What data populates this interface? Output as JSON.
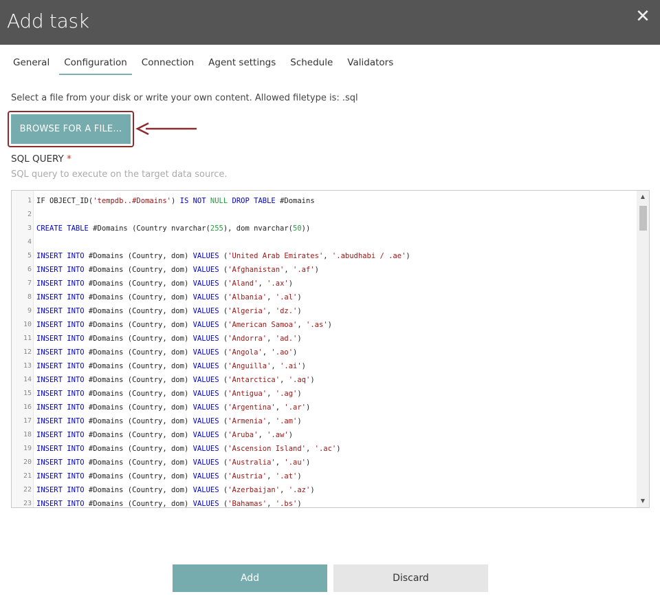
{
  "dialog": {
    "title": "Add task",
    "close_icon": "close-icon"
  },
  "tabs": [
    {
      "label": "General"
    },
    {
      "label": "Configuration",
      "active": true
    },
    {
      "label": "Connection"
    },
    {
      "label": "Agent settings"
    },
    {
      "label": "Schedule"
    },
    {
      "label": "Validators"
    }
  ],
  "config": {
    "hint": "Select a file from your disk or write your own content. Allowed filetype is: .sql",
    "browse_label": "BROWSE FOR A FILE...",
    "field_label": "SQL QUERY",
    "required_mark": "*",
    "field_help": "SQL query to execute on the target data source."
  },
  "editor": {
    "lines": [
      [
        [
          "t",
          "IF OBJECT_ID("
        ],
        [
          "s",
          "'tempdb..#Domains'"
        ],
        [
          "t",
          ") "
        ],
        [
          "k",
          "IS NOT"
        ],
        [
          "t",
          " "
        ],
        [
          "g",
          "NULL"
        ],
        [
          "t",
          " "
        ],
        [
          "k",
          "DROP TABLE"
        ],
        [
          "t",
          " #Domains"
        ]
      ],
      [],
      [
        [
          "k",
          "CREATE TABLE"
        ],
        [
          "t",
          " #Domains (Country nvarchar("
        ],
        [
          "n",
          "255"
        ],
        [
          "t",
          "), dom nvarchar("
        ],
        [
          "n",
          "50"
        ],
        [
          "t",
          "))"
        ]
      ],
      [],
      [
        [
          "k",
          "INSERT INTO"
        ],
        [
          "t",
          " #Domains (Country, dom) "
        ],
        [
          "k",
          "VALUES"
        ],
        [
          "t",
          " ("
        ],
        [
          "s",
          "'United Arab Emirates'"
        ],
        [
          "t",
          ", "
        ],
        [
          "s",
          "'.abudhabi / .ae'"
        ],
        [
          "t",
          ")"
        ]
      ],
      [
        [
          "k",
          "INSERT INTO"
        ],
        [
          "t",
          " #Domains (Country, dom) "
        ],
        [
          "k",
          "VALUES"
        ],
        [
          "t",
          " ("
        ],
        [
          "s",
          "'Afghanistan'"
        ],
        [
          "t",
          ", "
        ],
        [
          "s",
          "'.af'"
        ],
        [
          "t",
          ")"
        ]
      ],
      [
        [
          "k",
          "INSERT INTO"
        ],
        [
          "t",
          " #Domains (Country, dom) "
        ],
        [
          "k",
          "VALUES"
        ],
        [
          "t",
          " ("
        ],
        [
          "s",
          "'Aland'"
        ],
        [
          "t",
          ", "
        ],
        [
          "s",
          "'.ax'"
        ],
        [
          "t",
          ")"
        ]
      ],
      [
        [
          "k",
          "INSERT INTO"
        ],
        [
          "t",
          " #Domains (Country, dom) "
        ],
        [
          "k",
          "VALUES"
        ],
        [
          "t",
          " ("
        ],
        [
          "s",
          "'Albania'"
        ],
        [
          "t",
          ", "
        ],
        [
          "s",
          "'.al'"
        ],
        [
          "t",
          ")"
        ]
      ],
      [
        [
          "k",
          "INSERT INTO"
        ],
        [
          "t",
          " #Domains (Country, dom) "
        ],
        [
          "k",
          "VALUES"
        ],
        [
          "t",
          " ("
        ],
        [
          "s",
          "'Algeria'"
        ],
        [
          "t",
          ", "
        ],
        [
          "s",
          "'dz.'"
        ],
        [
          "t",
          ")"
        ]
      ],
      [
        [
          "k",
          "INSERT INTO"
        ],
        [
          "t",
          " #Domains (Country, dom) "
        ],
        [
          "k",
          "VALUES"
        ],
        [
          "t",
          " ("
        ],
        [
          "s",
          "'American Samoa'"
        ],
        [
          "t",
          ", "
        ],
        [
          "s",
          "'.as'"
        ],
        [
          "t",
          ")"
        ]
      ],
      [
        [
          "k",
          "INSERT INTO"
        ],
        [
          "t",
          " #Domains (Country, dom) "
        ],
        [
          "k",
          "VALUES"
        ],
        [
          "t",
          " ("
        ],
        [
          "s",
          "'Andorra'"
        ],
        [
          "t",
          ", "
        ],
        [
          "s",
          "'ad.'"
        ],
        [
          "t",
          ")"
        ]
      ],
      [
        [
          "k",
          "INSERT INTO"
        ],
        [
          "t",
          " #Domains (Country, dom) "
        ],
        [
          "k",
          "VALUES"
        ],
        [
          "t",
          " ("
        ],
        [
          "s",
          "'Angola'"
        ],
        [
          "t",
          ", "
        ],
        [
          "s",
          "'.ao'"
        ],
        [
          "t",
          ")"
        ]
      ],
      [
        [
          "k",
          "INSERT INTO"
        ],
        [
          "t",
          " #Domains (Country, dom) "
        ],
        [
          "k",
          "VALUES"
        ],
        [
          "t",
          " ("
        ],
        [
          "s",
          "'Anguilla'"
        ],
        [
          "t",
          ", "
        ],
        [
          "s",
          "'.ai'"
        ],
        [
          "t",
          ")"
        ]
      ],
      [
        [
          "k",
          "INSERT INTO"
        ],
        [
          "t",
          " #Domains (Country, dom) "
        ],
        [
          "k",
          "VALUES"
        ],
        [
          "t",
          " ("
        ],
        [
          "s",
          "'Antarctica'"
        ],
        [
          "t",
          ", "
        ],
        [
          "s",
          "'.aq'"
        ],
        [
          "t",
          ")"
        ]
      ],
      [
        [
          "k",
          "INSERT INTO"
        ],
        [
          "t",
          " #Domains (Country, dom) "
        ],
        [
          "k",
          "VALUES"
        ],
        [
          "t",
          " ("
        ],
        [
          "s",
          "'Antigua'"
        ],
        [
          "t",
          ", "
        ],
        [
          "s",
          "'.ag'"
        ],
        [
          "t",
          ")"
        ]
      ],
      [
        [
          "k",
          "INSERT INTO"
        ],
        [
          "t",
          " #Domains (Country, dom) "
        ],
        [
          "k",
          "VALUES"
        ],
        [
          "t",
          " ("
        ],
        [
          "s",
          "'Argentina'"
        ],
        [
          "t",
          ", "
        ],
        [
          "s",
          "'.ar'"
        ],
        [
          "t",
          ")"
        ]
      ],
      [
        [
          "k",
          "INSERT INTO"
        ],
        [
          "t",
          " #Domains (Country, dom) "
        ],
        [
          "k",
          "VALUES"
        ],
        [
          "t",
          " ("
        ],
        [
          "s",
          "'Armenia'"
        ],
        [
          "t",
          ", "
        ],
        [
          "s",
          "'.am'"
        ],
        [
          "t",
          ")"
        ]
      ],
      [
        [
          "k",
          "INSERT INTO"
        ],
        [
          "t",
          " #Domains (Country, dom) "
        ],
        [
          "k",
          "VALUES"
        ],
        [
          "t",
          " ("
        ],
        [
          "s",
          "'Aruba'"
        ],
        [
          "t",
          ", "
        ],
        [
          "s",
          "'.aw'"
        ],
        [
          "t",
          ")"
        ]
      ],
      [
        [
          "k",
          "INSERT INTO"
        ],
        [
          "t",
          " #Domains (Country, dom) "
        ],
        [
          "k",
          "VALUES"
        ],
        [
          "t",
          " ("
        ],
        [
          "s",
          "'Ascension Island'"
        ],
        [
          "t",
          ", "
        ],
        [
          "s",
          "'.ac'"
        ],
        [
          "t",
          ")"
        ]
      ],
      [
        [
          "k",
          "INSERT INTO"
        ],
        [
          "t",
          " #Domains (Country, dom) "
        ],
        [
          "k",
          "VALUES"
        ],
        [
          "t",
          " ("
        ],
        [
          "s",
          "'Australia'"
        ],
        [
          "t",
          ", "
        ],
        [
          "s",
          "'.au'"
        ],
        [
          "t",
          ")"
        ]
      ],
      [
        [
          "k",
          "INSERT INTO"
        ],
        [
          "t",
          " #Domains (Country, dom) "
        ],
        [
          "k",
          "VALUES"
        ],
        [
          "t",
          " ("
        ],
        [
          "s",
          "'Austria'"
        ],
        [
          "t",
          ", "
        ],
        [
          "s",
          "'.at'"
        ],
        [
          "t",
          ")"
        ]
      ],
      [
        [
          "k",
          "INSERT INTO"
        ],
        [
          "t",
          " #Domains (Country, dom) "
        ],
        [
          "k",
          "VALUES"
        ],
        [
          "t",
          " ("
        ],
        [
          "s",
          "'Azerbaijan'"
        ],
        [
          "t",
          ", "
        ],
        [
          "s",
          "'.az'"
        ],
        [
          "t",
          ")"
        ]
      ],
      [
        [
          "k",
          "INSERT INTO"
        ],
        [
          "t",
          " #Domains (Country, dom) "
        ],
        [
          "k",
          "VALUES"
        ],
        [
          "t",
          " ("
        ],
        [
          "s",
          "'Bahamas'"
        ],
        [
          "t",
          ", "
        ],
        [
          "s",
          "'.bs'"
        ],
        [
          "t",
          ")"
        ]
      ]
    ]
  },
  "footer": {
    "add_label": "Add",
    "discard_label": "Discard"
  },
  "colors": {
    "header_bg": "#555555",
    "accent": "#76acae",
    "annotation": "#8b2c2f",
    "keyword": "#0000cc",
    "string": "#a31515",
    "number": "#1f9d3a"
  }
}
